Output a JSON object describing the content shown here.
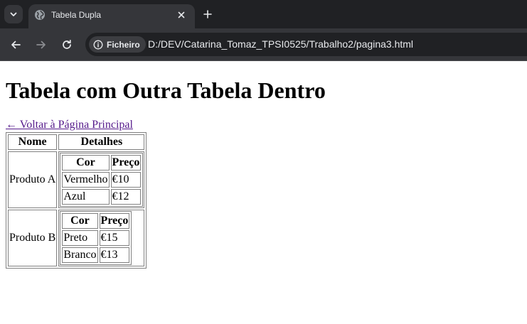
{
  "browser": {
    "tab_title": "Tabela Dupla",
    "security_chip": "Ficheiro",
    "url": "D:/DEV/Catarina_Tomaz_TPSI0525/Trabalho2/pagina3.html"
  },
  "page": {
    "heading": "Tabela com Outra Tabela Dentro",
    "back_link": "← Voltar à Página Principal",
    "table": {
      "headers": [
        "Nome",
        "Detalhes"
      ],
      "rows": [
        {
          "name": "Produto A",
          "inner": {
            "headers": [
              "Cor",
              "Preço"
            ],
            "rows": [
              [
                "Vermelho",
                "€10"
              ],
              [
                "Azul",
                "€12"
              ]
            ]
          }
        },
        {
          "name": "Produto B",
          "inner": {
            "headers": [
              "Cor",
              "Preço"
            ],
            "rows": [
              [
                "Preto",
                "€15"
              ],
              [
                "Branco",
                "€13"
              ]
            ]
          }
        }
      ]
    }
  },
  "icons": {
    "tab_search": "chevron-down-icon",
    "favicon": "globe-icon",
    "tab_close": "close-icon",
    "new_tab": "plus-icon",
    "back": "arrow-left-icon",
    "forward": "arrow-right-icon",
    "reload": "reload-icon",
    "info": "info-icon"
  },
  "colors": {
    "chrome_dark": "#202124",
    "chrome_toolbar": "#35363a",
    "visited_link": "#551a8b"
  }
}
